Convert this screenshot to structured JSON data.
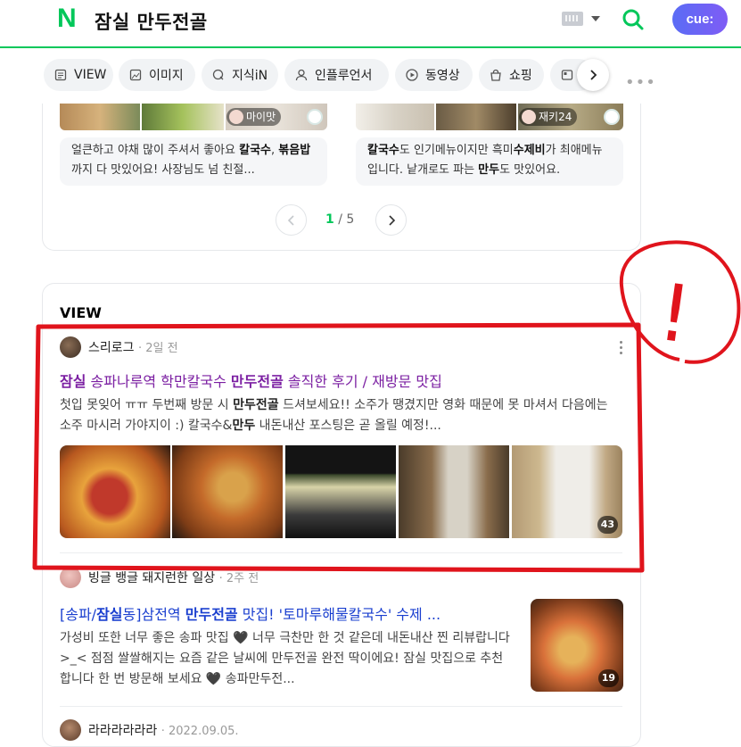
{
  "header": {
    "logo_letter": "N",
    "query": "잠실 만두전골",
    "cue_label": "cue:"
  },
  "tabs": [
    {
      "label": "VIEW",
      "icon": "document-icon"
    },
    {
      "label": "이미지",
      "icon": "image-icon"
    },
    {
      "label": "지식iN",
      "icon": "q-icon"
    },
    {
      "label": "인플루언서",
      "icon": "person-icon"
    },
    {
      "label": "동영상",
      "icon": "play-icon"
    },
    {
      "label": "쇼핑",
      "icon": "bag-icon"
    }
  ],
  "top_card": {
    "badge_left": "마이맛",
    "badge_right": "재키24",
    "snippet_left": {
      "pre": "얼큰하고 야채 많이 주셔서 좋아요 ",
      "b1": "칼국수",
      "mid": ",",
      "b2": "볶음밥",
      "post": "까지 다 맛있어요! 사장님도 넘 친절..."
    },
    "snippet_right": {
      "b1": "칼국수",
      "pre": "도 인기메뉴이지만 흑미",
      "b2": "수제비",
      "mid": "가 최애메뉴입니다. 낱개로도 파는 ",
      "b3": "만두",
      "post": "도 맛있어요."
    },
    "pager": {
      "current": "1",
      "sep": "/",
      "total": "5"
    }
  },
  "view_section": {
    "title": "VIEW",
    "posts": [
      {
        "author": "스리로그",
        "when": "· 2일 전",
        "title": {
          "b1": "잠실",
          "t1": " 송파나루역 학만칼국수 ",
          "b2": "만두전골",
          "t2": " 솔직한 후기 / 재방문 맛집"
        },
        "body": {
          "t1": "첫입 못잊어 ㅠㅠ 두번째 방문 시 ",
          "b1": "만두전골",
          "t2": " 드셔보세요!! 소주가 땡겼지만 영화 때문에 못 마셔서 다음에는 소주 마시러 가야지이 :) 칼국수&",
          "b2": "만두",
          "t3": " 내돈내산 포스팅은 곧 올릴 예정!..."
        },
        "image_count": "43"
      },
      {
        "author": "빙글 뱅글 돼지런한 일상",
        "when": "· 2주 전",
        "title": {
          "t1": "[송파/",
          "b1": "잠실",
          "t2": "동]삼전역 ",
          "b2": "만두전골",
          "t3": " 맛집! '토마루해물칼국수' 수제 ..."
        },
        "body": {
          "t1": "가성비 또한 너무 좋은 송파 맛집 🖤 너무 극찬만 한 것 같은데 내돈내산 찐 리뷰랍니다 >_< 점점 쌀쌀해지는 요즘 같은 날씨에 만두전골 완전 딱이에요! 잠실 맛집으로 추천합니다 한 번 방문해 보세요 🖤 송파만두전..."
        },
        "image_count": "19"
      },
      {
        "author": "라라라라라라",
        "when": "· 2022.09.05."
      }
    ]
  },
  "annotation": {
    "label": "!",
    "color": "#e0141c"
  }
}
